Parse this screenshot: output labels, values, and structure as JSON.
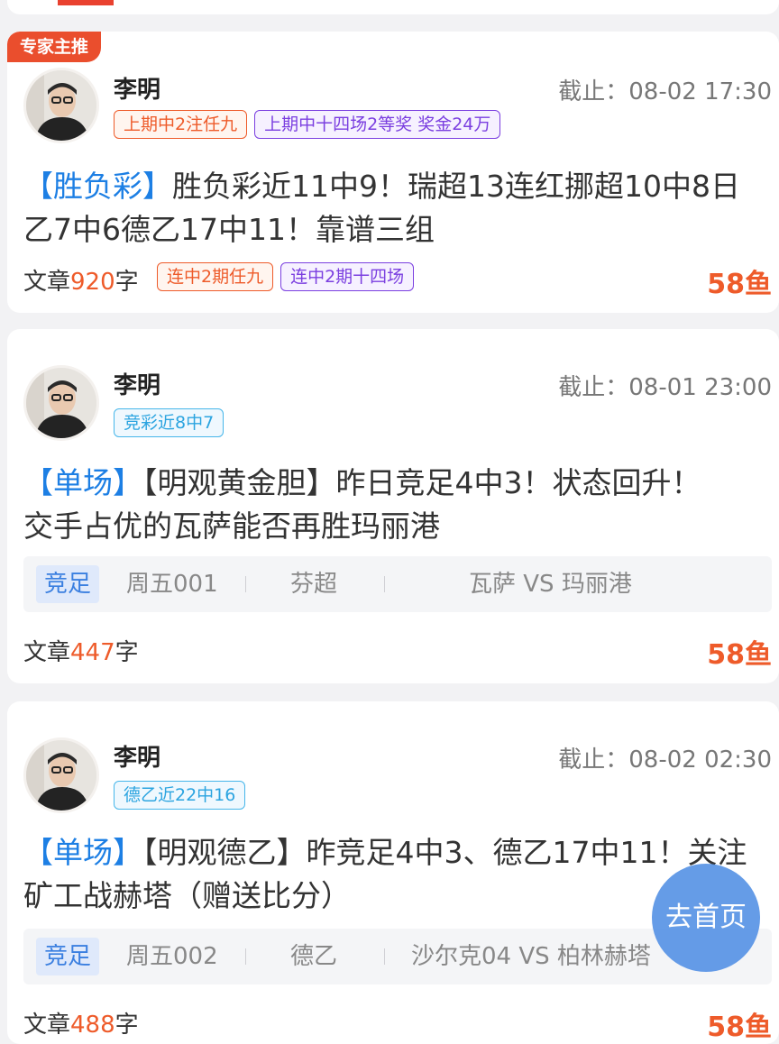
{
  "cards": [
    {
      "expert_badge": "专家主推",
      "author": "李明",
      "deadline": "截止：08-02 17:30",
      "tags": [
        "上期中2注任九",
        "上期中十四场2等奖 奖金24万"
      ],
      "title_category": "【胜负彩】",
      "title_text": "胜负彩近11中9！瑞超13连红挪超10中8日乙7中6德乙17中11！靠谱三组",
      "words_prefix": "文章",
      "words_count": "920",
      "words_suffix": "字",
      "stat_tags": [
        "连中2期任九",
        "连中2期十四场"
      ],
      "price": "58鱼"
    },
    {
      "author": "李明",
      "deadline": "截止：08-01 23:00",
      "tags": [
        "竞彩近8中7"
      ],
      "title_category": "【单场】",
      "title_text": "【明观黄金胆】昨日竞足4中3！状态回升！交手占优的瓦萨能否再胜玛丽港",
      "match": {
        "type": "竞足",
        "code": "周五001",
        "league": "芬超",
        "teams": "瓦萨 VS 玛丽港"
      },
      "words_prefix": "文章",
      "words_count": "447",
      "words_suffix": "字",
      "price": "58鱼"
    },
    {
      "author": "李明",
      "deadline": "截止：08-02 02:30",
      "tags": [
        "德乙近22中16"
      ],
      "title_category": "【单场】",
      "title_text": "【明观德乙】昨竞足4中3、德乙17中11！关注矿工战赫塔（赠送比分）",
      "match": {
        "type": "竞足",
        "code": "周五002",
        "league": "德乙",
        "teams": "沙尔克04 VS 柏林赫塔"
      },
      "words_prefix": "文章",
      "words_count": "488",
      "words_suffix": "字",
      "price": "58鱼"
    }
  ],
  "home_button": "去首页"
}
